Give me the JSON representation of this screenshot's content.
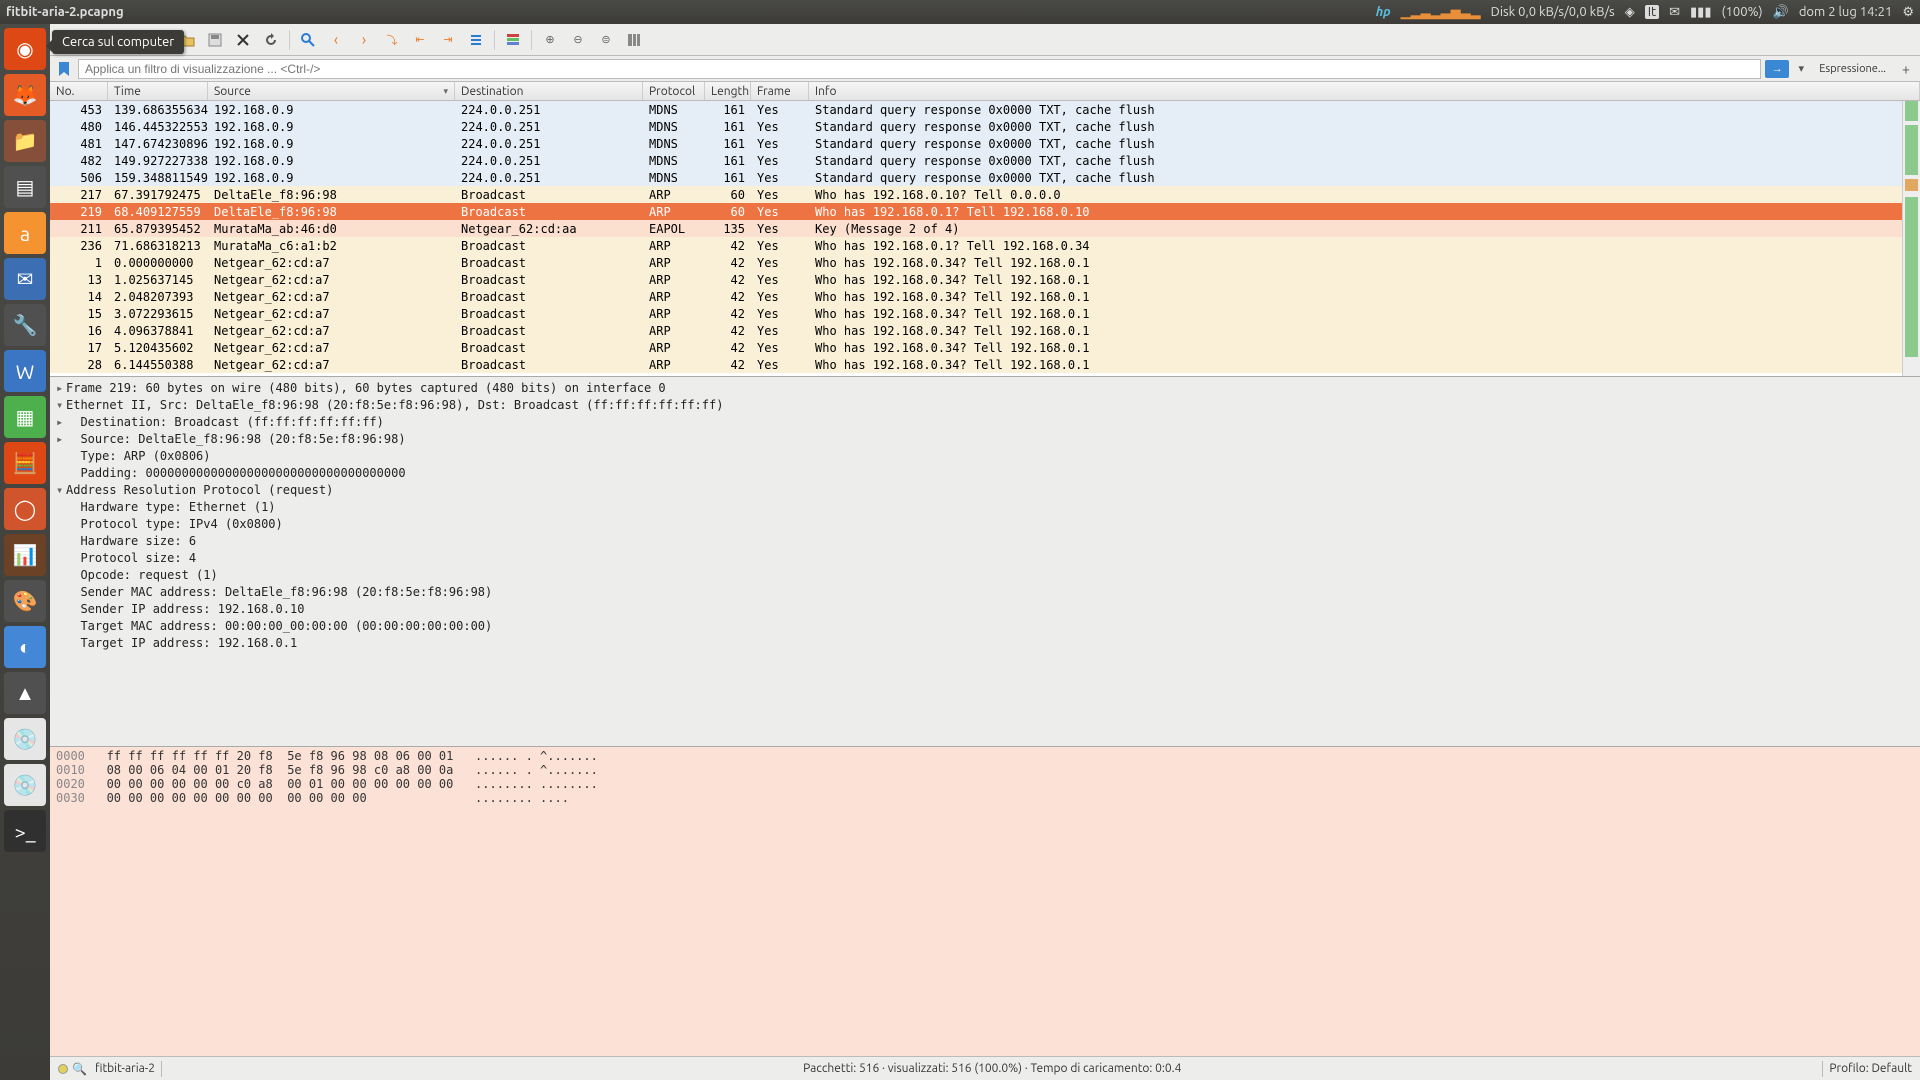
{
  "menubar": {
    "title": "fitbit-aria-2.pcapng",
    "disk": "Disk 0,0 kB/s/0,0 kB/s",
    "kbd": "It",
    "battery": "(100%)",
    "datetime": "dom  2 lug 14:21"
  },
  "tooltip": "Cerca sul computer",
  "launcher": {
    "colors": [
      "#dd4814",
      "#e55b25",
      "#864f3a",
      "#505050",
      "#f59331",
      "#3c6eb4",
      "#505050",
      "#3a76c4",
      "#4db04d",
      "#dd4814",
      "#d0542c",
      "#6b4226",
      "#505050",
      "#4387d6",
      "#505050",
      "#e6e6e6",
      "#e6e6e6",
      "#303030"
    ]
  },
  "filter": {
    "placeholder": "Applica un filtro di visualizzazione ... <Ctrl-/>",
    "expr": "Espressione..."
  },
  "columns": {
    "no": "No.",
    "time": "Time",
    "source": "Source",
    "dest": "Destination",
    "proto": "Protocol",
    "len": "Length",
    "frame": "Frame",
    "info": "Info"
  },
  "packets": [
    {
      "no": "453",
      "time": "139.686355634",
      "src": "192.168.0.9",
      "dst": "224.0.0.251",
      "proto": "MDNS",
      "len": "161",
      "frame": "Yes",
      "info": "Standard query response 0x0000 TXT, cache flush",
      "cls": "bg-blue"
    },
    {
      "no": "480",
      "time": "146.445322553",
      "src": "192.168.0.9",
      "dst": "224.0.0.251",
      "proto": "MDNS",
      "len": "161",
      "frame": "Yes",
      "info": "Standard query response 0x0000 TXT, cache flush",
      "cls": "bg-blue"
    },
    {
      "no": "481",
      "time": "147.674230896",
      "src": "192.168.0.9",
      "dst": "224.0.0.251",
      "proto": "MDNS",
      "len": "161",
      "frame": "Yes",
      "info": "Standard query response 0x0000 TXT, cache flush",
      "cls": "bg-blue"
    },
    {
      "no": "482",
      "time": "149.927227338",
      "src": "192.168.0.9",
      "dst": "224.0.0.251",
      "proto": "MDNS",
      "len": "161",
      "frame": "Yes",
      "info": "Standard query response 0x0000 TXT, cache flush",
      "cls": "bg-blue"
    },
    {
      "no": "506",
      "time": "159.348811549",
      "src": "192.168.0.9",
      "dst": "224.0.0.251",
      "proto": "MDNS",
      "len": "161",
      "frame": "Yes",
      "info": "Standard query response 0x0000 TXT, cache flush",
      "cls": "bg-blue"
    },
    {
      "no": "217",
      "time": "67.391792475",
      "src": "DeltaEle_f8:96:98",
      "dst": "Broadcast",
      "proto": "ARP",
      "len": "60",
      "frame": "Yes",
      "info": "Who has 192.168.0.10? Tell 0.0.0.0",
      "cls": "bg-cream"
    },
    {
      "no": "219",
      "time": "68.409127559",
      "src": "DeltaEle_f8:96:98",
      "dst": "Broadcast",
      "proto": "ARP",
      "len": "60",
      "frame": "Yes",
      "info": "Who has 192.168.0.1? Tell 192.168.0.10",
      "cls": "bg-sel"
    },
    {
      "no": "211",
      "time": "65.879395452",
      "src": "MurataMa_ab:46:d0",
      "dst": "Netgear_62:cd:aa",
      "proto": "EAPOL",
      "len": "135",
      "frame": "Yes",
      "info": "Key (Message 2 of 4)",
      "cls": "bg-pink"
    },
    {
      "no": "236",
      "time": "71.686318213",
      "src": "MurataMa_c6:a1:b2",
      "dst": "Broadcast",
      "proto": "ARP",
      "len": "42",
      "frame": "Yes",
      "info": "Who has 192.168.0.1? Tell 192.168.0.34",
      "cls": "bg-cream"
    },
    {
      "no": "1",
      "time": "0.000000000",
      "src": "Netgear_62:cd:a7",
      "dst": "Broadcast",
      "proto": "ARP",
      "len": "42",
      "frame": "Yes",
      "info": "Who has 192.168.0.34? Tell 192.168.0.1",
      "cls": "bg-cream"
    },
    {
      "no": "13",
      "time": "1.025637145",
      "src": "Netgear_62:cd:a7",
      "dst": "Broadcast",
      "proto": "ARP",
      "len": "42",
      "frame": "Yes",
      "info": "Who has 192.168.0.34? Tell 192.168.0.1",
      "cls": "bg-cream"
    },
    {
      "no": "14",
      "time": "2.048207393",
      "src": "Netgear_62:cd:a7",
      "dst": "Broadcast",
      "proto": "ARP",
      "len": "42",
      "frame": "Yes",
      "info": "Who has 192.168.0.34? Tell 192.168.0.1",
      "cls": "bg-cream"
    },
    {
      "no": "15",
      "time": "3.072293615",
      "src": "Netgear_62:cd:a7",
      "dst": "Broadcast",
      "proto": "ARP",
      "len": "42",
      "frame": "Yes",
      "info": "Who has 192.168.0.34? Tell 192.168.0.1",
      "cls": "bg-cream"
    },
    {
      "no": "16",
      "time": "4.096378841",
      "src": "Netgear_62:cd:a7",
      "dst": "Broadcast",
      "proto": "ARP",
      "len": "42",
      "frame": "Yes",
      "info": "Who has 192.168.0.34? Tell 192.168.0.1",
      "cls": "bg-cream"
    },
    {
      "no": "17",
      "time": "5.120435602",
      "src": "Netgear_62:cd:a7",
      "dst": "Broadcast",
      "proto": "ARP",
      "len": "42",
      "frame": "Yes",
      "info": "Who has 192.168.0.34? Tell 192.168.0.1",
      "cls": "bg-cream"
    },
    {
      "no": "28",
      "time": "6.144550388",
      "src": "Netgear_62:cd:a7",
      "dst": "Broadcast",
      "proto": "ARP",
      "len": "42",
      "frame": "Yes",
      "info": "Who has 192.168.0.34? Tell 192.168.0.1",
      "cls": "bg-cream"
    }
  ],
  "details": [
    {
      "ind": 0,
      "tri": "▸",
      "t": "Frame 219: 60 bytes on wire (480 bits), 60 bytes captured (480 bits) on interface 0"
    },
    {
      "ind": 0,
      "tri": "▾",
      "t": "Ethernet II, Src: DeltaEle_f8:96:98 (20:f8:5e:f8:96:98), Dst: Broadcast (ff:ff:ff:ff:ff:ff)"
    },
    {
      "ind": 1,
      "tri": "▸",
      "t": "Destination: Broadcast (ff:ff:ff:ff:ff:ff)"
    },
    {
      "ind": 1,
      "tri": "▸",
      "t": "Source: DeltaEle_f8:96:98 (20:f8:5e:f8:96:98)"
    },
    {
      "ind": 1,
      "tri": "",
      "t": "Type: ARP (0x0806)"
    },
    {
      "ind": 1,
      "tri": "",
      "t": "Padding: 000000000000000000000000000000000000"
    },
    {
      "ind": 0,
      "tri": "▾",
      "t": "Address Resolution Protocol (request)"
    },
    {
      "ind": 1,
      "tri": "",
      "t": "Hardware type: Ethernet (1)"
    },
    {
      "ind": 1,
      "tri": "",
      "t": "Protocol type: IPv4 (0x0800)"
    },
    {
      "ind": 1,
      "tri": "",
      "t": "Hardware size: 6"
    },
    {
      "ind": 1,
      "tri": "",
      "t": "Protocol size: 4"
    },
    {
      "ind": 1,
      "tri": "",
      "t": "Opcode: request (1)"
    },
    {
      "ind": 1,
      "tri": "",
      "t": "Sender MAC address: DeltaEle_f8:96:98 (20:f8:5e:f8:96:98)"
    },
    {
      "ind": 1,
      "tri": "",
      "t": "Sender IP address: 192.168.0.10"
    },
    {
      "ind": 1,
      "tri": "",
      "t": "Target MAC address: 00:00:00_00:00:00 (00:00:00:00:00:00)"
    },
    {
      "ind": 1,
      "tri": "",
      "t": "Target IP address: 192.168.0.1"
    }
  ],
  "hex": [
    {
      "off": "0000",
      "b": "ff ff ff ff ff ff 20 f8  5e f8 96 98 08 06 00 01",
      "a": "...... . ^......."
    },
    {
      "off": "0010",
      "b": "08 00 06 04 00 01 20 f8  5e f8 96 98 c0 a8 00 0a",
      "a": "...... . ^......."
    },
    {
      "off": "0020",
      "b": "00 00 00 00 00 00 c0 a8  00 01 00 00 00 00 00 00",
      "a": "........ ........"
    },
    {
      "off": "0030",
      "b": "00 00 00 00 00 00 00 00  00 00 00 00",
      "a": "........ ...."
    }
  ],
  "status": {
    "file": "fitbit-aria-2",
    "mid": "Pacchetti: 516 · visualizzati: 516 (100.0%) · Tempo di caricamento: 0:0.4",
    "profile": "Profilo: Default"
  }
}
